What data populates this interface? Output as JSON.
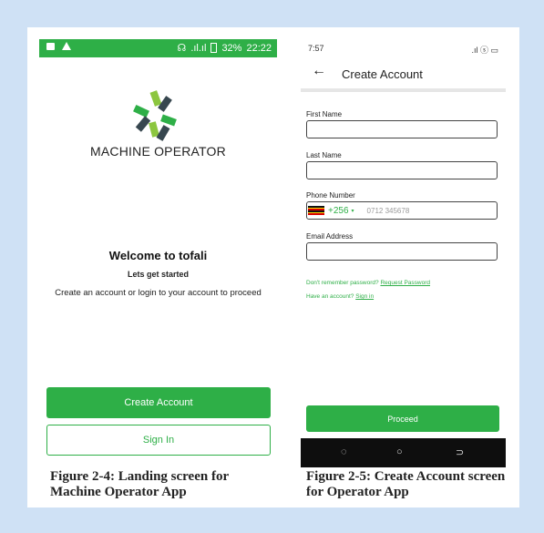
{
  "left_screen": {
    "status_bar": {
      "signal_text": ".ıl.ıl",
      "battery_percent": "32%",
      "time": "22:22"
    },
    "brand_name": "MACHINE OPERATOR",
    "welcome_title": "Welcome to tofali",
    "subtitle": "Lets get started",
    "instruction": "Create an account or login to your account to proceed",
    "create_account_label": "Create Account",
    "sign_in_label": "Sign In"
  },
  "right_screen": {
    "status_bar": {
      "time": "7:57",
      "right_text": ".ıl ⓢ ▭"
    },
    "title": "Create Account",
    "fields": {
      "first_name_label": "First Name",
      "last_name_label": "Last Name",
      "phone_label": "Phone Number",
      "country_code": "+256",
      "phone_placeholder": "0712 345678",
      "email_label": "Email Address"
    },
    "forgot_text": "Don't remember password?",
    "request_password_link": "Request Password",
    "have_account_text": "Have an account?",
    "sign_in_link": "Sign in",
    "proceed_label": "Proceed"
  },
  "captions": {
    "left": "Figure 2-4: Landing screen for Machine Operator App",
    "right": "Figure 2-5: Create Account screen for Operator App"
  },
  "colors": {
    "accent_green": "#2eaf47",
    "background_blue": "#cfe1f5"
  }
}
